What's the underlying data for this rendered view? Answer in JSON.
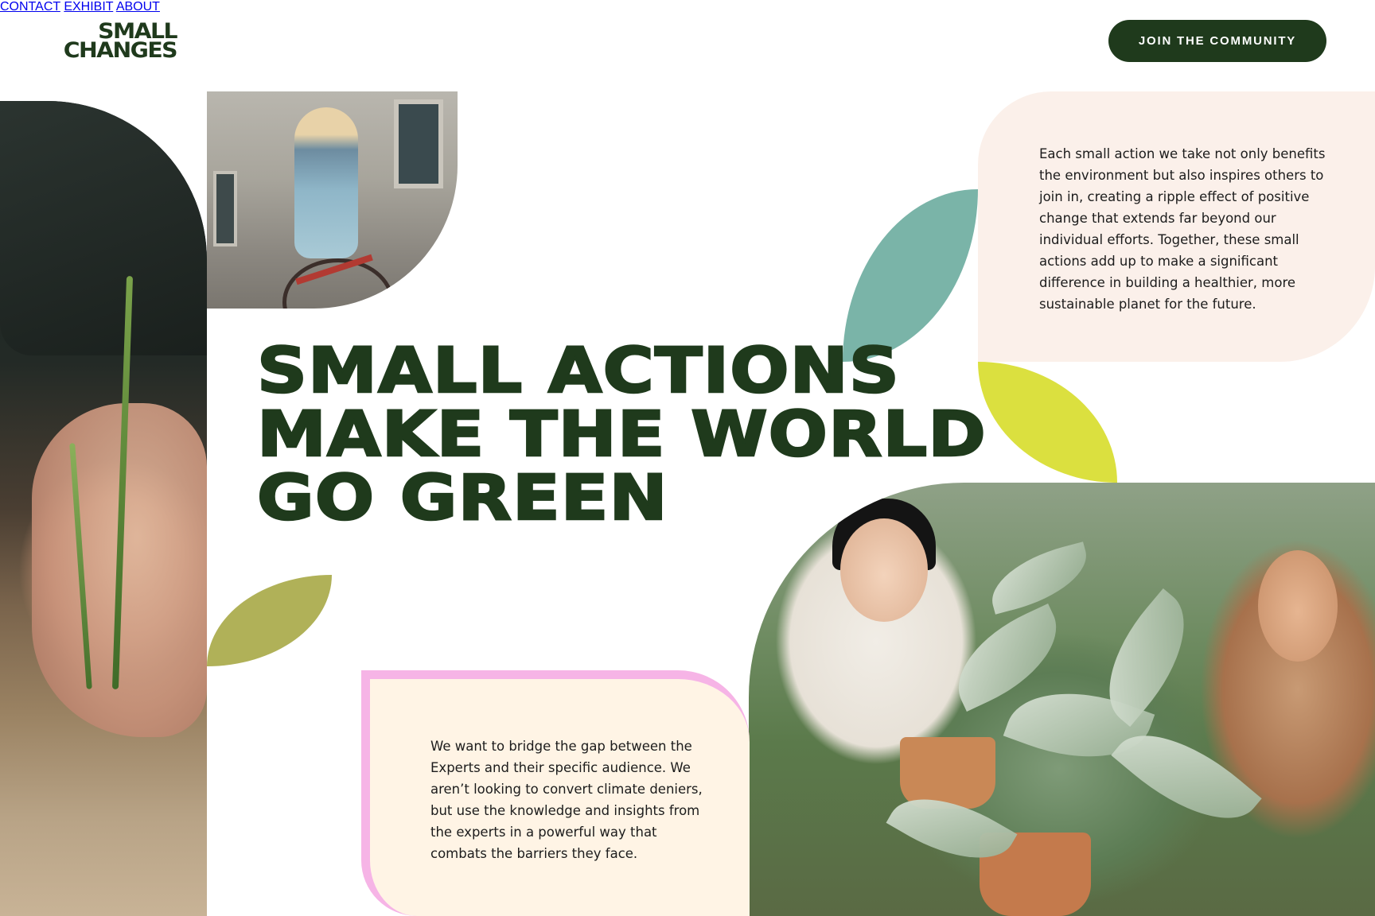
{
  "brand": {
    "logo_line1": "SMALL",
    "logo_line2": "CHANGES"
  },
  "nav": {
    "items": [
      {
        "label": "CONTACT"
      },
      {
        "label": "EXHIBIT"
      },
      {
        "label": "ABOUT"
      }
    ],
    "cta_label": "JOIN THE COMMUNITY"
  },
  "hero": {
    "headline": [
      "SMALL ACTIONS",
      "MAKE THE WORLD",
      "GO GREEN"
    ]
  },
  "card_top": {
    "text": "Each small action we take not only benefits the environment but also inspires others to join in, creating a ripple effect of positive change that extends far beyond our individual efforts. Together, these small actions add up to make a significant difference in building a healthier, more sustainable planet for the future."
  },
  "card_bottom": {
    "text": "We want to bridge the gap between the Experts and their specific audience. We aren’t looking to convert climate deniers, but use the knowledge and insights from the experts in a powerful way that combats the barriers they face."
  },
  "colors": {
    "brand_green": "#1f3a1c",
    "teal": "#7ab4a8",
    "lime": "#dbe03f",
    "olive": "#b0b158",
    "pink_border": "#f6b4e6",
    "card_top_bg": "#fbf0ea",
    "card_bottom_bg": "#fff4e5"
  }
}
